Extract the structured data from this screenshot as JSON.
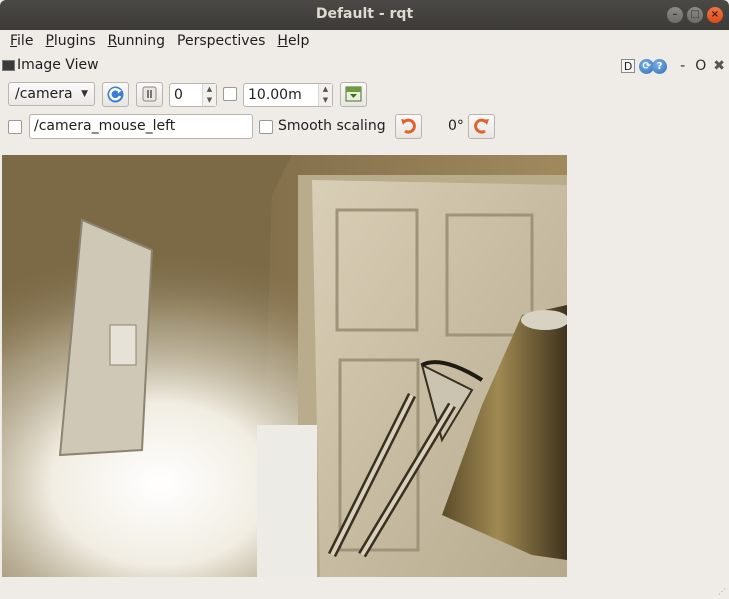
{
  "window": {
    "title": "Default - rqt",
    "minimize": "–",
    "maximize": "□",
    "close": "×"
  },
  "menubar": [
    {
      "accel": "F",
      "rest": "ile"
    },
    {
      "accel": "P",
      "rest": "lugins"
    },
    {
      "accel": "R",
      "rest": "unning"
    },
    {
      "accel": "P",
      "rest": "erspectives"
    },
    {
      "accel": "H",
      "rest": "elp"
    }
  ],
  "plugin": {
    "title": "Image View",
    "d_label": "D",
    "help_label": "?",
    "hide_label": "-",
    "restore_label": "O",
    "close_label": "✖"
  },
  "toolbar": {
    "topic": "/camera",
    "refresh_icon": "refresh-icon",
    "pause_icon": "pause-icon",
    "frame_value": "0",
    "timeout_value": "10.00m",
    "save_icon": "save-image-icon",
    "mouse_topic": "/camera_mouse_left",
    "smooth_scaling_label": "Smooth scaling",
    "rotate_left_icon": "rotate-ccw-icon",
    "rotation_label": "0°",
    "rotate_right_icon": "rotate-cw-icon"
  },
  "colors": {
    "accent_refresh": "#3a7fd0",
    "accent_rotate": "#e0632a"
  }
}
